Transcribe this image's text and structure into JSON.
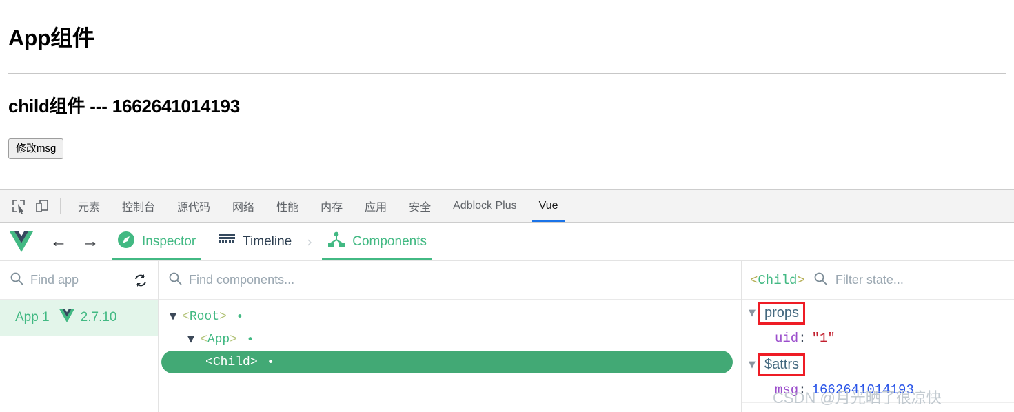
{
  "page": {
    "heading": "App组件",
    "subheading": "child组件 --- 1662641014193",
    "button_label": "修改msg"
  },
  "devtools": {
    "icons": {
      "inspect": "inspect-element-icon",
      "device": "device-toolbar-icon"
    },
    "tabs": [
      {
        "label": "元素",
        "active": false
      },
      {
        "label": "控制台",
        "active": false
      },
      {
        "label": "源代码",
        "active": false
      },
      {
        "label": "网络",
        "active": false
      },
      {
        "label": "性能",
        "active": false
      },
      {
        "label": "内存",
        "active": false
      },
      {
        "label": "应用",
        "active": false
      },
      {
        "label": "安全",
        "active": false
      },
      {
        "label": "Adblock Plus",
        "active": false
      },
      {
        "label": "Vue",
        "active": true
      }
    ],
    "active_tab_accent": "#1a73e8"
  },
  "vue_devtools": {
    "logo": "vue-logo-icon",
    "nav": {
      "back": "←",
      "forward": "→"
    },
    "tabs": [
      {
        "label": "Inspector",
        "icon": "compass-icon",
        "active": true
      },
      {
        "label": "Timeline",
        "icon": "timeline-icon",
        "active": false
      },
      {
        "label": "Components",
        "icon": "component-tree-icon",
        "active": true
      }
    ],
    "separator": "›",
    "accent_green": "#42b983",
    "apps_panel": {
      "search_placeholder": "Find app",
      "refresh_icon": "refresh-icon",
      "selected_app": {
        "name": "App 1",
        "version": "2.7.10",
        "logo": "vue-logo-icon"
      }
    },
    "tree_panel": {
      "search_placeholder": "Find components...",
      "nodes": [
        {
          "angle_open": "<",
          "name": "Root",
          "angle_close": ">",
          "depth": 1,
          "expanded": true,
          "has_dot": true,
          "selected": false
        },
        {
          "angle_open": "<",
          "name": "App",
          "angle_close": ">",
          "depth": 2,
          "expanded": true,
          "has_dot": true,
          "selected": false
        },
        {
          "angle_open": "<",
          "name": "Child",
          "angle_close": ">",
          "depth": 3,
          "expanded": false,
          "has_dot": true,
          "selected": true
        }
      ],
      "caret_glyph": "▼"
    },
    "state_panel": {
      "component_angle_open": "<",
      "component_name": "Child",
      "component_angle_close": ">",
      "filter_placeholder": "Filter state...",
      "groups": [
        {
          "label": "props",
          "expanded": true,
          "highlighted": true,
          "entries": [
            {
              "key": "uid",
              "colon": ":",
              "value": "\"1\"",
              "value_type": "string"
            }
          ]
        },
        {
          "label": "$attrs",
          "expanded": true,
          "highlighted": true,
          "entries": [
            {
              "key": "msg",
              "colon": ":",
              "value": "1662641014193",
              "value_type": "number"
            }
          ]
        }
      ],
      "annotation_color": "#ee1c25"
    }
  },
  "watermark": {
    "text": "CSDN @月光晒了很凉快"
  }
}
